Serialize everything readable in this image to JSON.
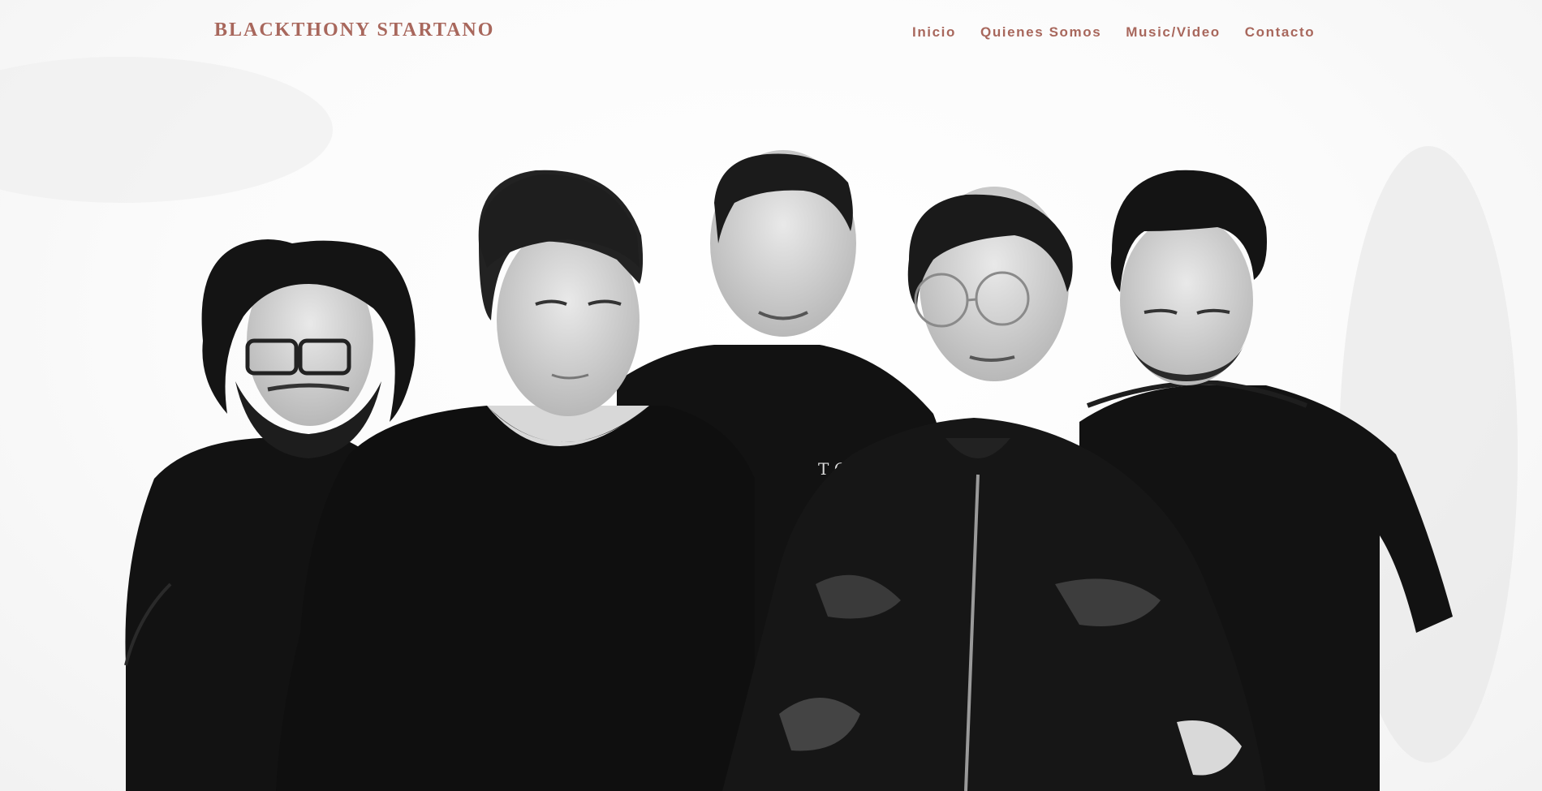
{
  "header": {
    "brand": "BLACKTHONY STARTANO",
    "nav": [
      {
        "label": "Inicio"
      },
      {
        "label": "Quienes Somos"
      },
      {
        "label": "Music/Video"
      },
      {
        "label": "Contacto"
      }
    ]
  },
  "hero": {
    "photo_shirt_text": "T O."
  },
  "colors": {
    "accent": "#a8675c",
    "background": "#ffffff",
    "shirt": "#111111"
  }
}
